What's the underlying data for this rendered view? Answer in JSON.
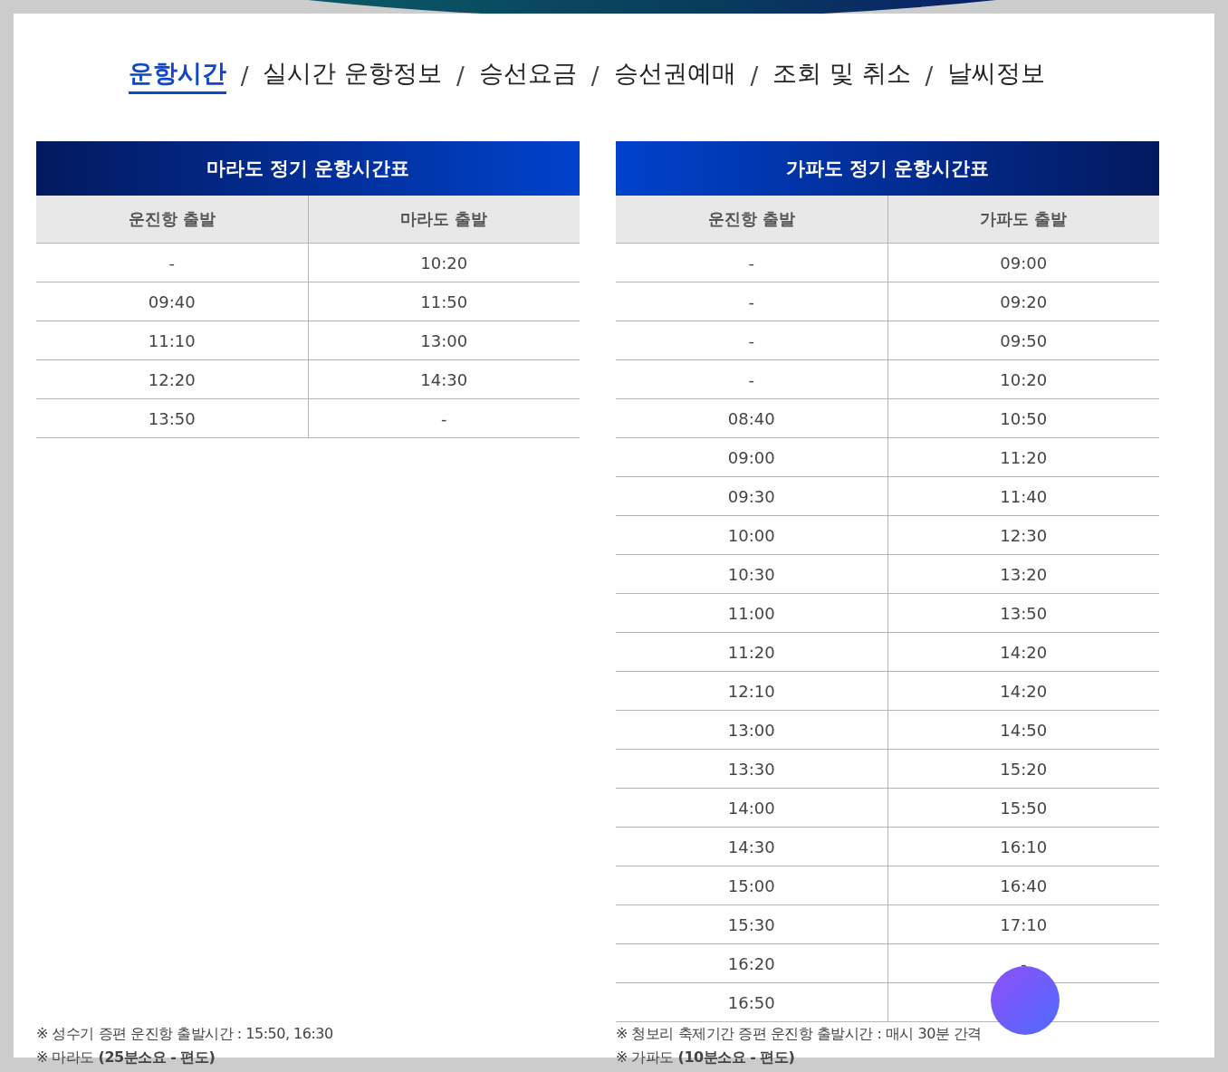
{
  "nav": {
    "separator": "/",
    "items": [
      {
        "label": "운항시간",
        "selected": true
      },
      {
        "label": "실시간 운항정보",
        "selected": false
      },
      {
        "label": "승선요금",
        "selected": false
      },
      {
        "label": "승선권예매",
        "selected": false
      },
      {
        "label": "조회 및 취소",
        "selected": false
      },
      {
        "label": "날씨정보",
        "selected": false
      }
    ]
  },
  "timetables": [
    {
      "title": "마라도 정기 운항시간표",
      "columns": [
        "운진항 출발",
        "마라도 출발"
      ],
      "rows": [
        [
          "-",
          "10:20"
        ],
        [
          "09:40",
          "11:50"
        ],
        [
          "11:10",
          "13:00"
        ],
        [
          "12:20",
          "14:30"
        ],
        [
          "13:50",
          "-"
        ]
      ],
      "notes": [
        "※ 성수기 증편 운진항 출발시간 : 15:50, 16:30",
        "※ 마라도 **(25분소요 - 편도)**"
      ]
    },
    {
      "title": "가파도 정기 운항시간표",
      "columns": [
        "운진항 출발",
        "가파도 출발"
      ],
      "rows": [
        [
          "-",
          "09:00"
        ],
        [
          "-",
          "09:20"
        ],
        [
          "-",
          "09:50"
        ],
        [
          "-",
          "10:20"
        ],
        [
          "08:40",
          "10:50"
        ],
        [
          "09:00",
          "11:20"
        ],
        [
          "09:30",
          "11:40"
        ],
        [
          "10:00",
          "12:30"
        ],
        [
          "10:30",
          "13:20"
        ],
        [
          "11:00",
          "13:50"
        ],
        [
          "11:20",
          "14:20"
        ],
        [
          "12:10",
          "14:20"
        ],
        [
          "13:00",
          "14:50"
        ],
        [
          "13:30",
          "15:20"
        ],
        [
          "14:00",
          "15:50"
        ],
        [
          "14:30",
          "16:10"
        ],
        [
          "15:00",
          "16:40"
        ],
        [
          "15:30",
          "17:10"
        ],
        [
          "16:20",
          "-"
        ],
        [
          "16:50"
        ]
      ],
      "notes": [
        "※ 청보리 축제기간 증편 운진항 출발시간 : 매시 30분 간격",
        "※ 가파도 **(10분소요 - 편도)**"
      ]
    }
  ]
}
